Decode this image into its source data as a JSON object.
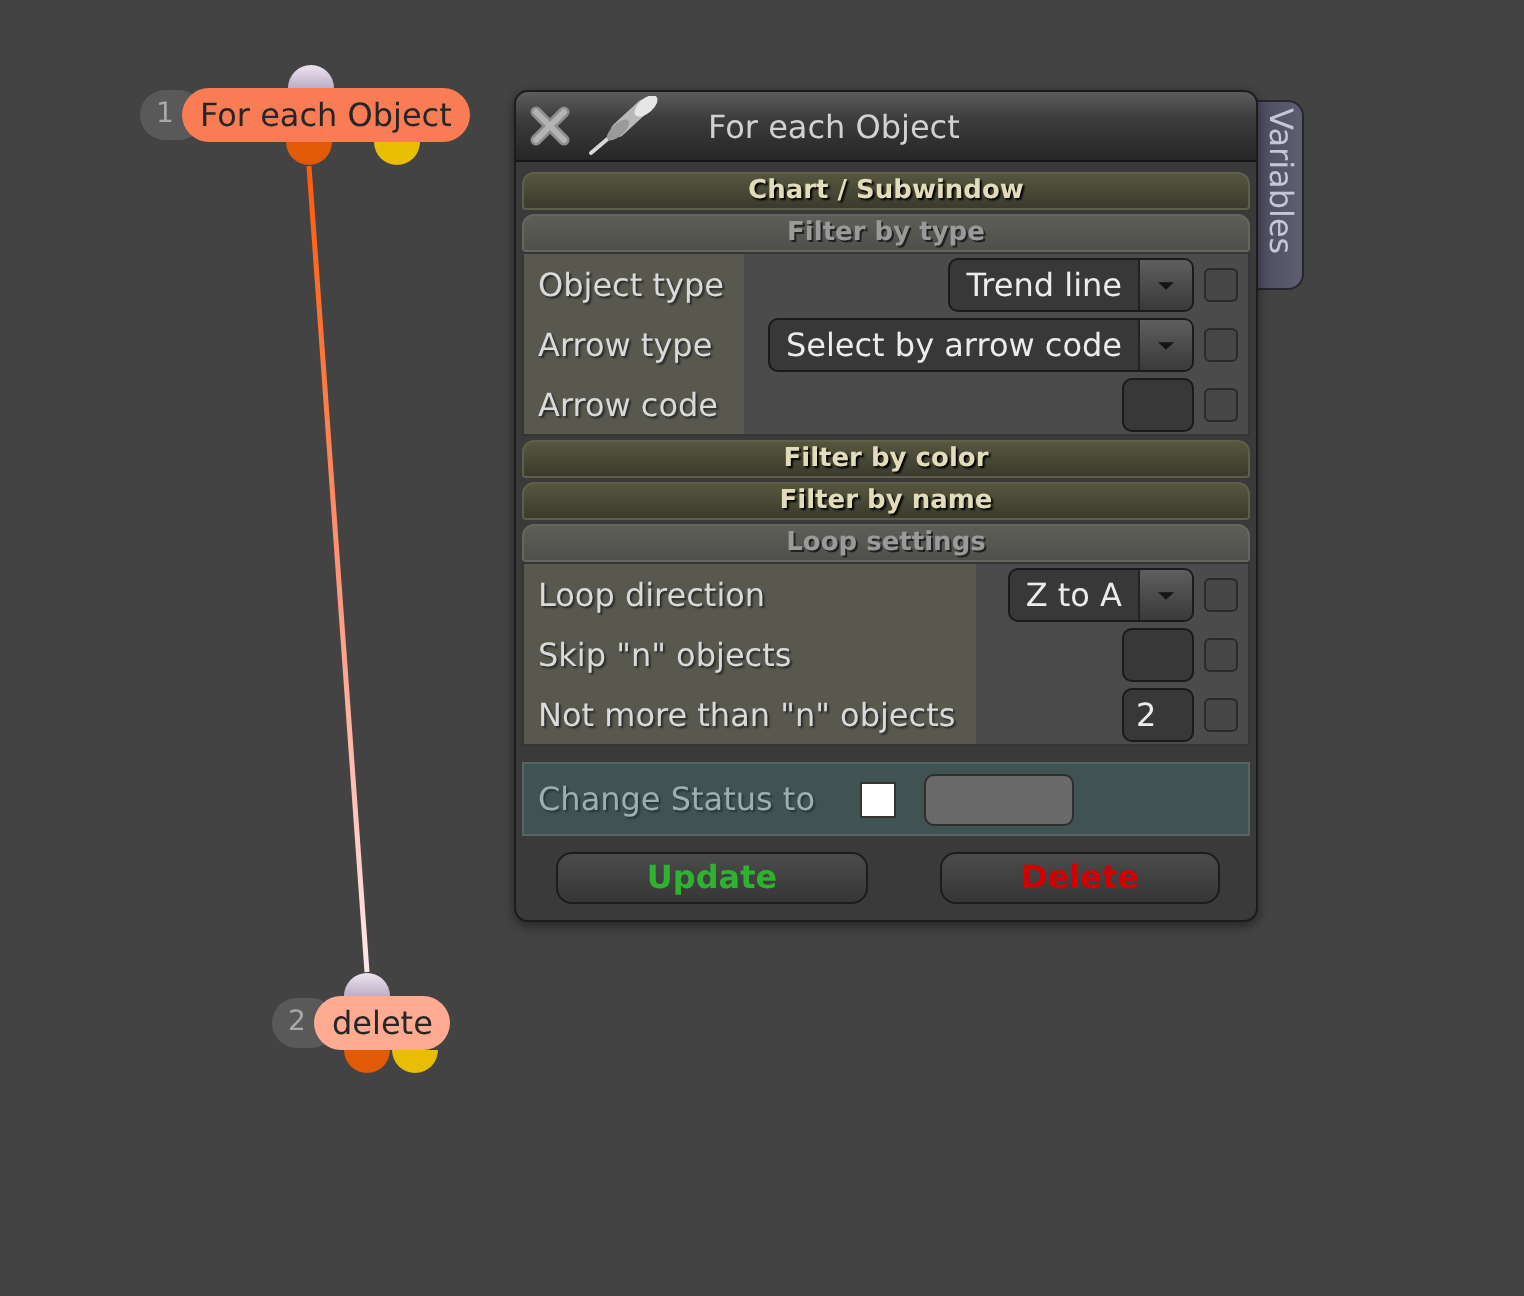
{
  "nodes": [
    {
      "number": "1",
      "label": "For each Object",
      "selected": true
    },
    {
      "number": "2",
      "label": "delete",
      "selected": false
    }
  ],
  "panel": {
    "title": "For each Object",
    "side_tab": "Variables",
    "sections": [
      {
        "title": "Chart / Subwindow",
        "expanded": false
      },
      {
        "title": "Filter by type",
        "expanded": true,
        "rows": [
          {
            "label": "Object type",
            "kind": "dropdown",
            "value": "Trend line",
            "checked": false
          },
          {
            "label": "Arrow type",
            "kind": "dropdown",
            "value": "Select by arrow code",
            "checked": false
          },
          {
            "label": "Arrow code",
            "kind": "field",
            "checked": false
          }
        ]
      },
      {
        "title": "Filter by color",
        "expanded": false
      },
      {
        "title": "Filter by name",
        "expanded": false
      },
      {
        "title": "Loop settings",
        "expanded": true,
        "rows": [
          {
            "label": "Loop direction",
            "kind": "dropdown",
            "value": "Z to A",
            "checked": false
          },
          {
            "label": "Skip \"n\" objects",
            "kind": "field",
            "checked": false
          },
          {
            "label": "Not more than \"n\" objects",
            "kind": "field",
            "value": "2",
            "checked": false
          }
        ]
      }
    ],
    "status": {
      "label": "Change Status to",
      "checked": false
    },
    "buttons": [
      {
        "label": "Update",
        "kind": "update"
      },
      {
        "label": "Delete",
        "kind": "delete"
      }
    ]
  }
}
